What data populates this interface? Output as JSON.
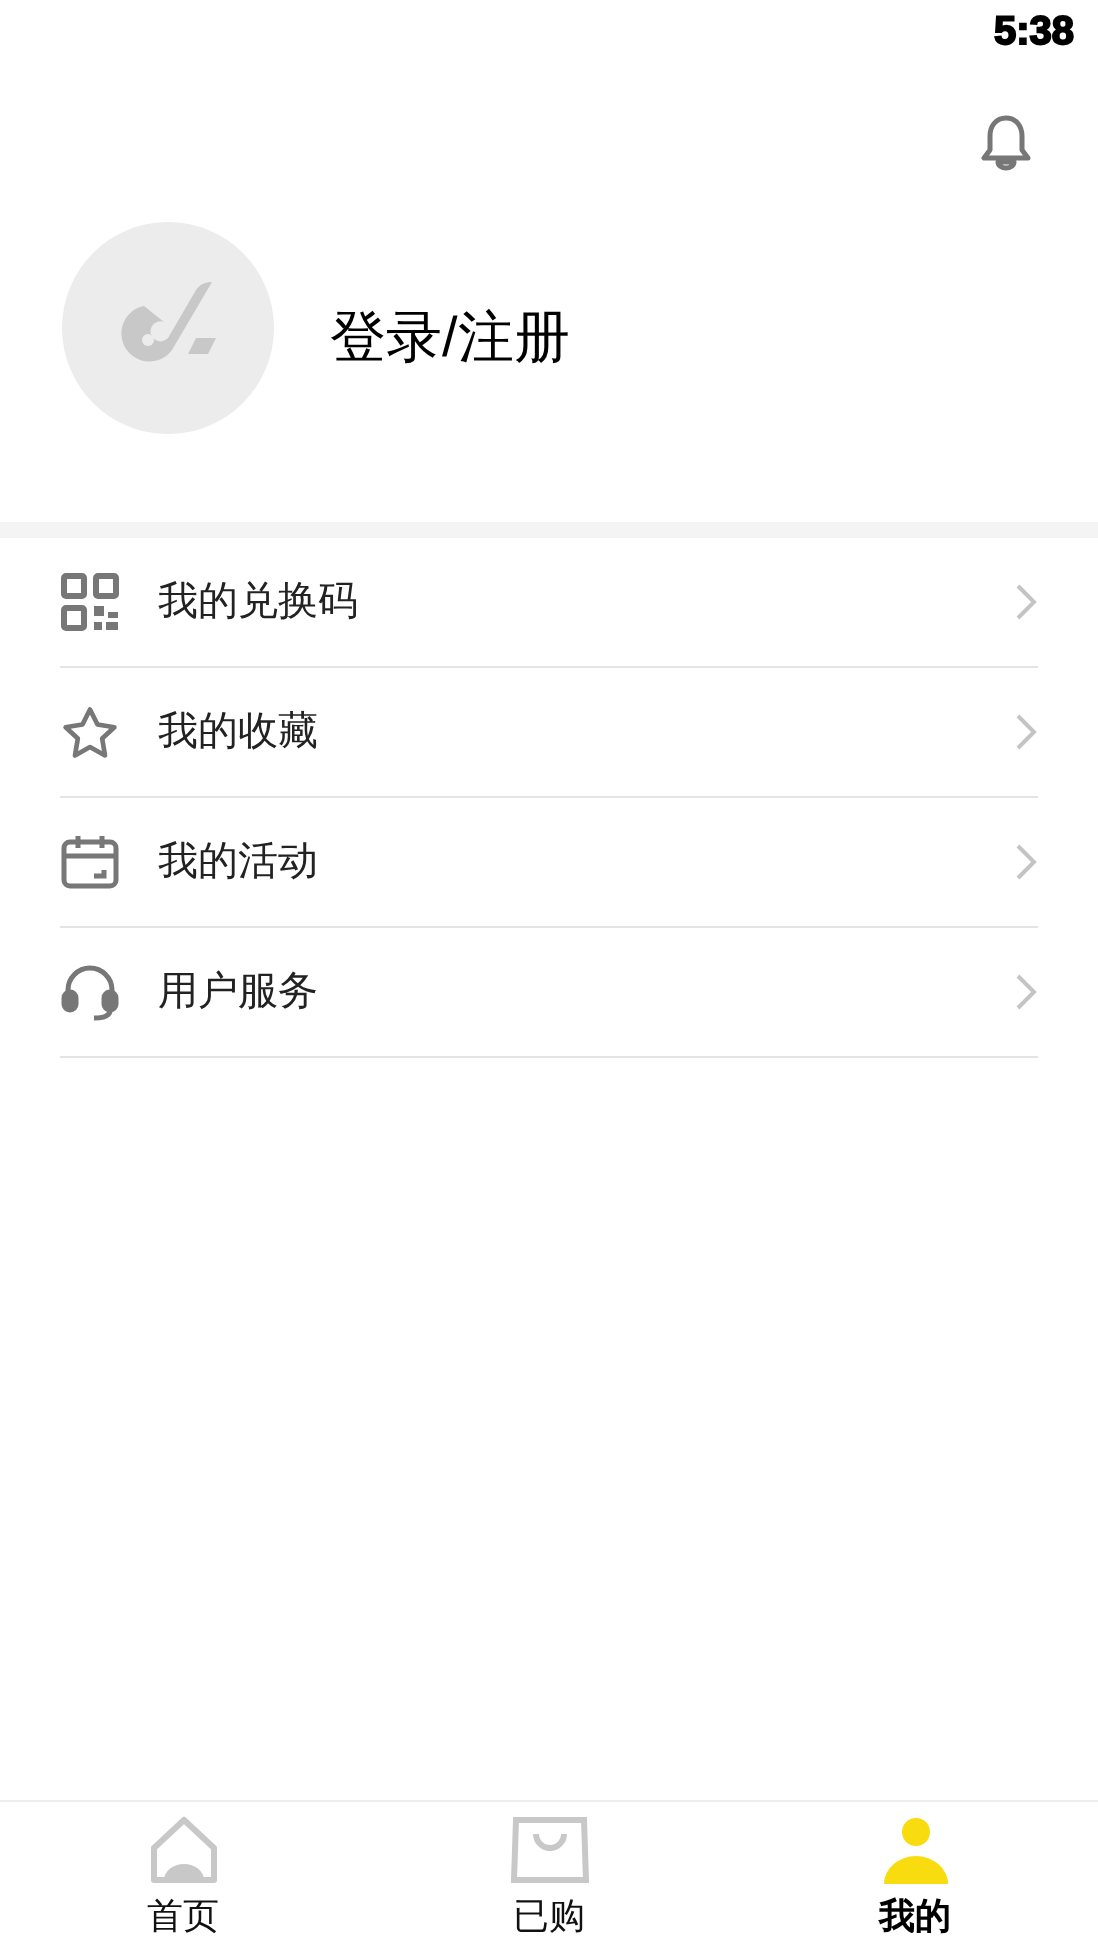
{
  "status_bar": {
    "time": "5:38"
  },
  "profile": {
    "login_label": "登录/注册"
  },
  "menu": [
    {
      "kind": "qrcode",
      "label": "我的兑换码"
    },
    {
      "kind": "star",
      "label": "我的收藏"
    },
    {
      "kind": "calendar",
      "label": "我的活动"
    },
    {
      "kind": "headset",
      "label": "用户服务"
    }
  ],
  "tabs": [
    {
      "kind": "home",
      "label": "首页",
      "selected": false
    },
    {
      "kind": "bag",
      "label": "已购",
      "selected": false
    },
    {
      "kind": "person",
      "label": "我的",
      "selected": true
    }
  ]
}
